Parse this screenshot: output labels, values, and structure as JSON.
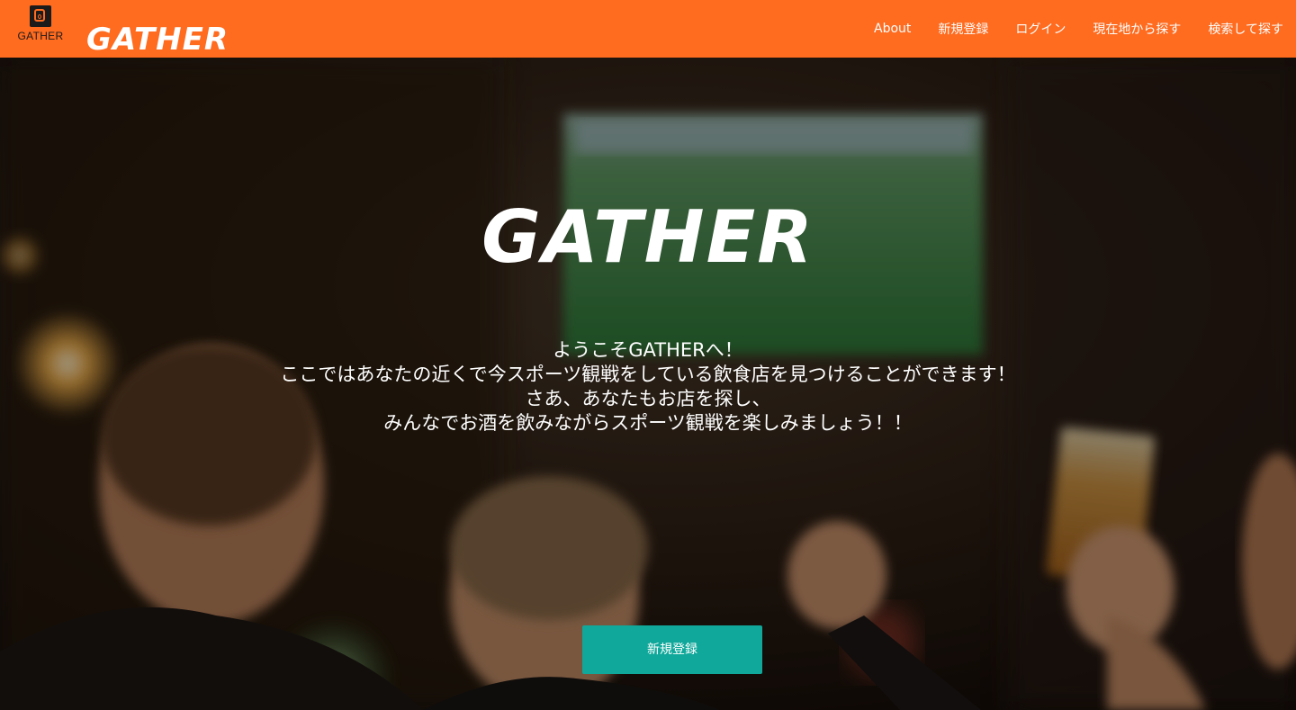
{
  "header": {
    "logo_mark_text": "GATHER",
    "brand_title": "GATHER",
    "nav": [
      {
        "label": "About"
      },
      {
        "label": "新規登録"
      },
      {
        "label": "ログイン"
      },
      {
        "label": "現在地から探す"
      },
      {
        "label": "検索して探す"
      }
    ],
    "background_color": "#ff6b1f"
  },
  "hero": {
    "title": "GATHER",
    "message_lines": [
      "ようこそGATHERへ！",
      "ここではあなたの近くで今スポーツ観戦をしている飲食店を見つけることができます！",
      "さあ、あなたもお店を探し、",
      "みんなでお酒を飲みながらスポーツ観戦を楽しみましょう！！"
    ],
    "cta_label": "新規登録",
    "cta_color": "#0fa89a"
  }
}
